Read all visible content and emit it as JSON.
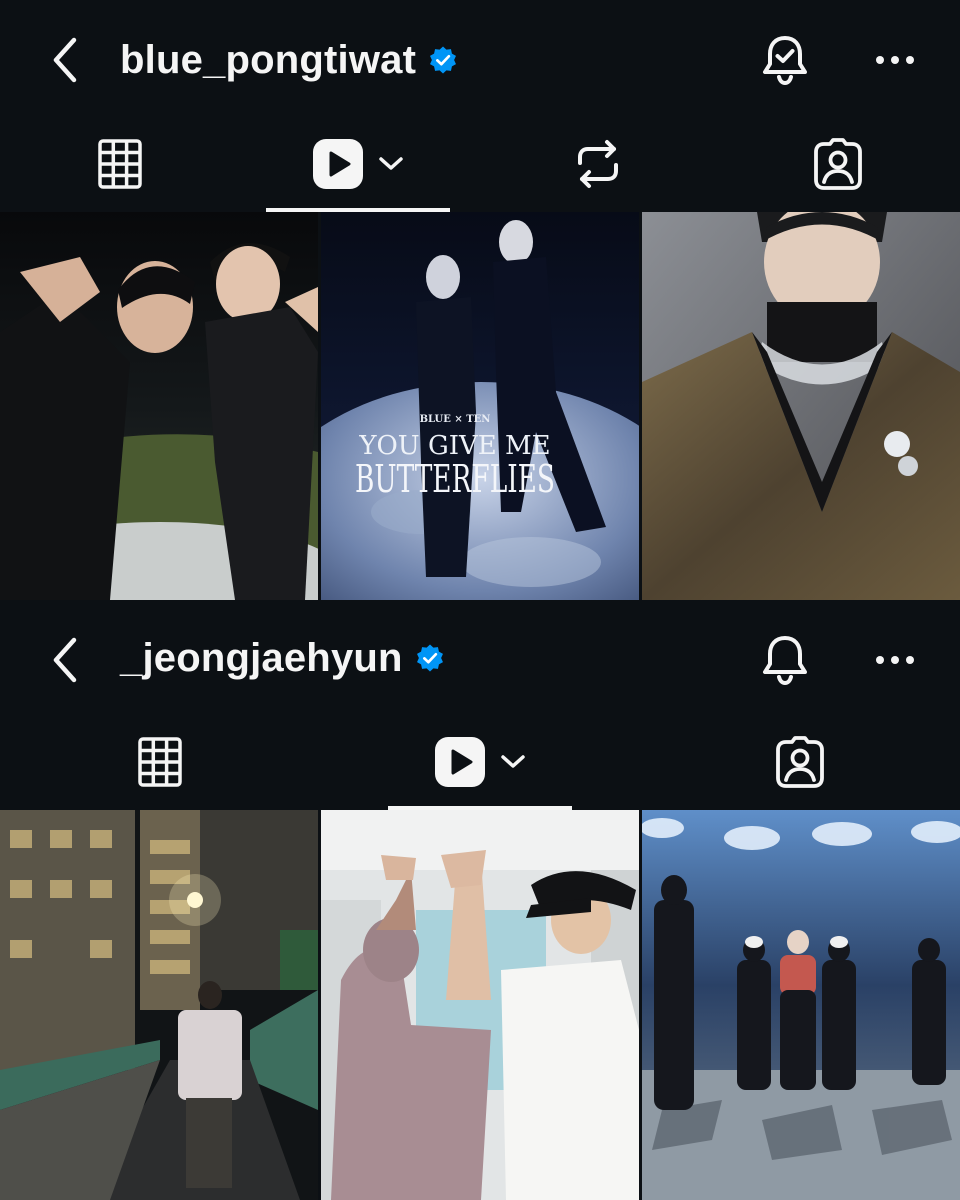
{
  "profiles": [
    {
      "username": "blue_pongtiwat",
      "verified": true,
      "notifications": "bell-check-icon",
      "tabs": [
        "grid-icon",
        "reels-icon",
        "reposts-icon",
        "tagged-icon"
      ],
      "active_tab": "reels",
      "reels": [
        {
          "description": "two men in black posing at night on grass"
        },
        {
          "title_top": "BLUE × TEN",
          "title": "YOU GIVE ME",
          "title2": "BUTTERFLIES"
        },
        {
          "description": "man in velvet jacket with necklace and brooch"
        }
      ]
    },
    {
      "username": "_jeongjaehyun",
      "verified": true,
      "notifications": "bell-icon",
      "tabs": [
        "grid-icon",
        "reels-icon",
        "tagged-icon"
      ],
      "active_tab": "reels",
      "reels": [
        {
          "description": "man walking on walkway between apartment buildings at night"
        },
        {
          "description": "two people high-fiving in hallway"
        },
        {
          "description": "dance group performing on stage with spotlights"
        }
      ]
    }
  ],
  "colors": {
    "background": "#0c1014",
    "text": "#f5f5f5",
    "verified_blue": "#0095f6",
    "icon": "#f5f5f5"
  }
}
